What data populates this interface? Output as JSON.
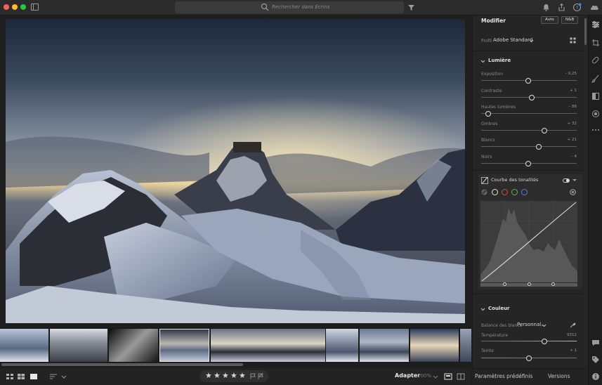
{
  "toolbar": {
    "search_placeholder": "Rechercher dans Ecrins"
  },
  "colors": {
    "traffic_close": "#ff5f57",
    "traffic_min": "#febc2e",
    "traffic_max": "#28c840",
    "accent": "#2f86eb"
  },
  "bottom": {
    "stars": [
      "★",
      "★",
      "★",
      "★",
      "★"
    ],
    "fit_label": "Adapter",
    "zoom_label": "100%"
  },
  "panel": {
    "title": "Modifier",
    "auto_button": "Auto",
    "bw_button": "N&B",
    "profile_label": "Profil",
    "profile_value": "Adobe Standard",
    "light_section": "Lumière",
    "sliders": [
      {
        "label": "Exposition",
        "value": "– 0,25",
        "level": 0.49
      },
      {
        "label": "Contraste",
        "value": "+ 1",
        "level": 0.53
      },
      {
        "label": "Hautes lumières",
        "value": "– 86",
        "level": 0.07
      },
      {
        "label": "Ombres",
        "value": "+ 32",
        "level": 0.66
      },
      {
        "label": "Blancs",
        "value": "+ 21",
        "level": 0.6
      },
      {
        "label": "Noirs",
        "value": "– 4",
        "level": 0.49
      }
    ],
    "curve_title": "Courbe des tonalités",
    "color_section": "Couleur",
    "wb_label": "Balance des blancs",
    "wb_value": "Personnal.",
    "temperature_label": "Température",
    "temperature_value": "9312",
    "temperature_level": 0.66,
    "tint_label": "Teinte",
    "tint_value": "+ 1",
    "tint_level": 0.5
  },
  "panel_tabs": {
    "presets": "Paramètres prédéfinis",
    "versions": "Versions"
  },
  "rail_icons": [
    "sliders-icon",
    "crop-icon",
    "healing-icon",
    "brush-icon",
    "gradient-icon",
    "radial-icon",
    "more-icon"
  ]
}
